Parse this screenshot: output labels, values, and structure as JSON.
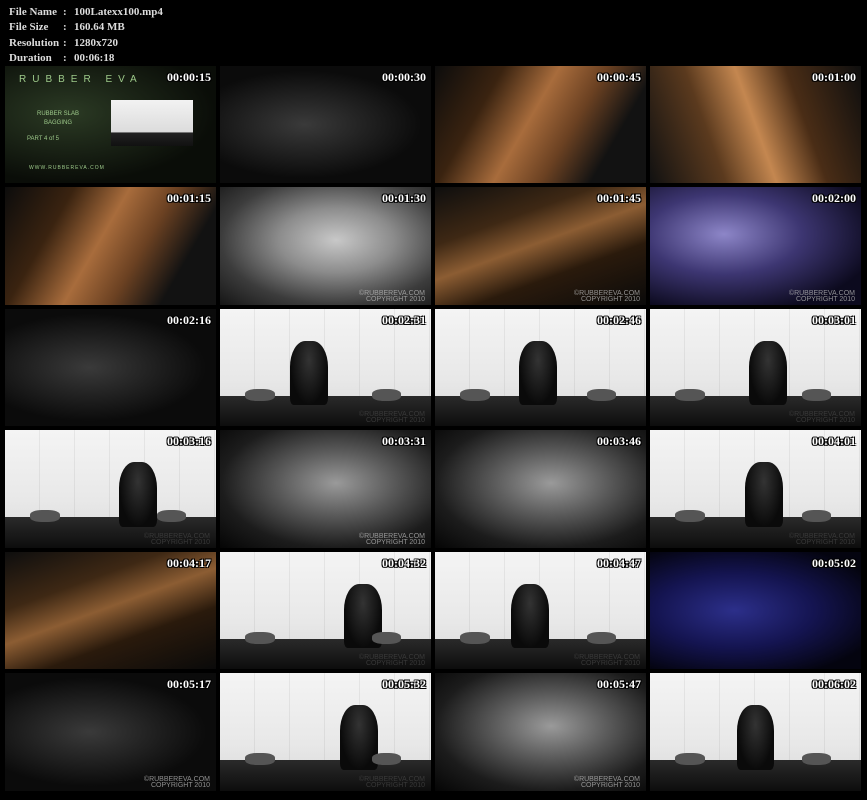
{
  "meta": {
    "file_name_label": "File Name",
    "file_name": "100Latexx100.mp4",
    "file_size_label": "File Size",
    "file_size": "160.64 MB",
    "resolution_label": "Resolution",
    "resolution": "1280x720",
    "duration_label": "Duration",
    "duration": "00:06:18",
    "separator": ":"
  },
  "title_card": {
    "logo": "RUBBER EVA",
    "subtitle": "RUBBER SLAB BAGGING",
    "part": "PART 4 of 5",
    "url": "WWW.RUBBEREVA.COM"
  },
  "watermark": {
    "line1": "©RUBBEREVA.COM",
    "line2": "COPYRIGHT 2010"
  },
  "thumbnails": [
    {
      "time": "00:00:15",
      "scene": "title",
      "wm": "none"
    },
    {
      "time": "00:00:30",
      "scene": "dark",
      "wm": "none"
    },
    {
      "time": "00:00:45",
      "scene": "skin",
      "wm": "none"
    },
    {
      "time": "00:01:00",
      "scene": "skin2",
      "wm": "none"
    },
    {
      "time": "00:01:15",
      "scene": "skin",
      "wm": "none"
    },
    {
      "time": "00:01:30",
      "scene": "clear",
      "wm": "light"
    },
    {
      "time": "00:01:45",
      "scene": "brown",
      "wm": "light"
    },
    {
      "time": "00:02:00",
      "scene": "purple",
      "wm": "light"
    },
    {
      "time": "00:02:16",
      "scene": "dark",
      "wm": "none"
    },
    {
      "time": "00:02:31",
      "scene": "studio",
      "wm": "dark"
    },
    {
      "time": "00:02:46",
      "scene": "studio",
      "wm": "none"
    },
    {
      "time": "00:03:01",
      "scene": "studio",
      "wm": "dark"
    },
    {
      "time": "00:03:16",
      "scene": "studio",
      "wm": "dark"
    },
    {
      "time": "00:03:31",
      "scene": "face",
      "wm": "light"
    },
    {
      "time": "00:03:46",
      "scene": "face",
      "wm": "none"
    },
    {
      "time": "00:04:01",
      "scene": "studio",
      "wm": "dark"
    },
    {
      "time": "00:04:17",
      "scene": "brown",
      "wm": "none"
    },
    {
      "time": "00:04:32",
      "scene": "studio",
      "wm": "dark"
    },
    {
      "time": "00:04:47",
      "scene": "studio",
      "wm": "dark"
    },
    {
      "time": "00:05:02",
      "scene": "blue",
      "wm": "none"
    },
    {
      "time": "00:05:17",
      "scene": "dark",
      "wm": "light"
    },
    {
      "time": "00:05:32",
      "scene": "studio",
      "wm": "dark"
    },
    {
      "time": "00:05:47",
      "scene": "face",
      "wm": "light"
    },
    {
      "time": "00:06:02",
      "scene": "studio",
      "wm": "none"
    }
  ]
}
